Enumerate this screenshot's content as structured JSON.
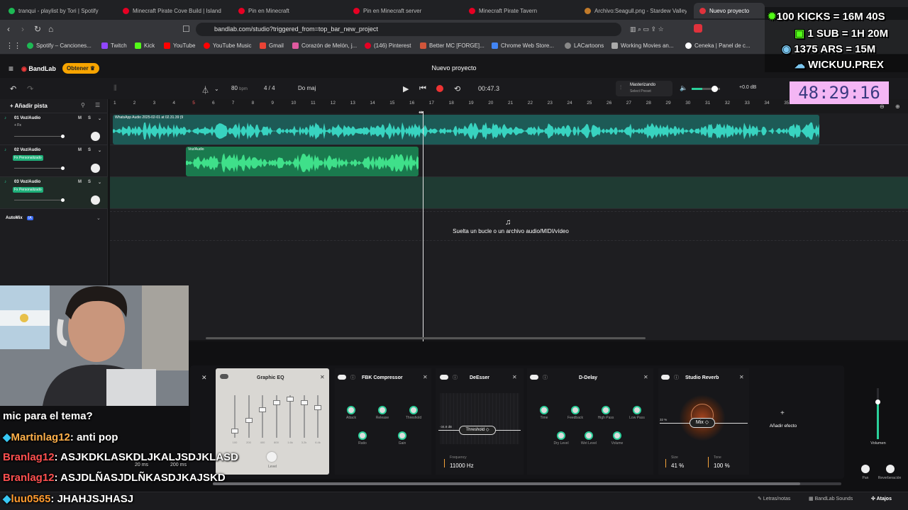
{
  "browser": {
    "tabs": [
      {
        "label": "tranqui - playlist by Tori | Spotify",
        "color": "#1db954"
      },
      {
        "label": "Minecraft Pirate Cove Build | Island",
        "color": "#e60023"
      },
      {
        "label": "Pin en Minecraft",
        "color": "#e60023"
      },
      {
        "label": "Pin en Minecraft server",
        "color": "#e60023"
      },
      {
        "label": "Minecraft Pirate Tavern",
        "color": "#e60023"
      },
      {
        "label": "Archivo:Seagull.png - Stardew Valley",
        "color": "#c27b2a"
      },
      {
        "label": "Nuevo proyecto",
        "color": "#e0323c"
      }
    ],
    "url": "bandlab.com/studio?triggered_from=top_bar_new_project",
    "bookmarks": [
      {
        "label": "Spotify – Canciones...",
        "color": "#1db954"
      },
      {
        "label": "Twitch",
        "color": "#9146ff"
      },
      {
        "label": "Kick",
        "color": "#53fc18"
      },
      {
        "label": "YouTube",
        "color": "#ff0000"
      },
      {
        "label": "YouTube Music",
        "color": "#ff0000"
      },
      {
        "label": "Gmail",
        "color": "#ea4335"
      },
      {
        "label": "Corazón de Melón, j...",
        "color": "#e05aa0"
      },
      {
        "label": "(146) Pinterest",
        "color": "#e60023"
      },
      {
        "label": "Better MC [FORGE]...",
        "color": "#d0553a"
      },
      {
        "label": "Chrome Web Store...",
        "color": "#4285f4"
      },
      {
        "label": "LACartoons",
        "color": "#888888"
      },
      {
        "label": "Working Movies an...",
        "color": "#aaaaaa"
      },
      {
        "label": "Ceneka | Panel de c...",
        "color": "#ffffff"
      }
    ]
  },
  "app": {
    "logo": "BandLab",
    "upgrade_label": "Obtener",
    "project_title": "Nuevo proyecto",
    "tempo": "80",
    "tempo_unit": "bpm",
    "time_sig": "4 / 4",
    "key": "Do maj",
    "time": "00:47.3",
    "mastering_title": "Masterizando",
    "mastering_sub": "Select Preset",
    "db": "+0.0 dB",
    "add_track": "Añadir pista",
    "automix": "AutoMix",
    "automix_badge": "IA",
    "drop_hint": "Suelta un bucle o un archivo audio/MIDI/vídeo",
    "tracks": [
      {
        "name": "01 Voz/Audio",
        "badge": "+ Fx"
      },
      {
        "name": "02 Voz/Audio",
        "badge": "Fx Personalizado"
      },
      {
        "name": "03 Voz/Audio",
        "badge": "Fx Personalizado"
      }
    ],
    "track_buttons": [
      "M",
      "S"
    ],
    "clips": [
      {
        "label": "WhatsApp Audio 2025-02-01 at 02.31.39 (9",
        "color": "#2fb5a8"
      },
      {
        "label": "Voz/Audio",
        "color": "#23b06f"
      }
    ],
    "ruler": [
      "1",
      "2",
      "3",
      "4",
      "5",
      "6",
      "7",
      "8",
      "9",
      "10",
      "11",
      "12",
      "13",
      "14",
      "15",
      "16",
      "17",
      "18",
      "19",
      "20",
      "21",
      "22",
      "23",
      "24",
      "25",
      "26",
      "27",
      "28",
      "29",
      "30",
      "31",
      "32",
      "33",
      "34",
      "35"
    ]
  },
  "effects": {
    "graphic_eq": {
      "title": "Graphic EQ",
      "level": "Level",
      "freqs": [
        "100",
        "200",
        "400",
        "800",
        "1.6k",
        "3.2k",
        "6.4k"
      ]
    },
    "compressor": {
      "title": "FBK Compressor",
      "knobs": [
        "Attack",
        "Release",
        "Threshold",
        "Ratio",
        "Gain"
      ]
    },
    "deesser": {
      "title": "DeEsser",
      "threshold_label": "Threshold",
      "threshold_value": "-34.8 dB",
      "freq_label": "Frequency",
      "freq_value": "11000 Hz"
    },
    "delay": {
      "title": "D-Delay",
      "knobs": [
        "Time",
        "Feedback",
        "High Pass",
        "Low Pass",
        "Dry Level",
        "Wet Level",
        "Volume"
      ]
    },
    "reverb": {
      "title": "Studio Reverb",
      "mix_label": "Mix",
      "mix_value": "32 %",
      "size_label": "Size",
      "size_value": "41 %",
      "tone_label": "Tone",
      "tone_value": "100 %"
    },
    "add_effect": "Añadir efecto",
    "volume_label": "Volumen",
    "pan_label": "Pan",
    "reverb_label": "Reverberación"
  },
  "statusbar": {
    "lyrics": "Letras/notas",
    "sounds": "BandLab Sounds",
    "shortcuts": "Atajos"
  },
  "stream_overlay": {
    "lines": [
      "100 KICKS = 16M 40S",
      "1 SUB = 1H 20M",
      "1375 ARS = 15M",
      "WICKUU.PREX"
    ],
    "timer": "48:29:16"
  },
  "chat": [
    {
      "user": "",
      "text": "mic para el tema?"
    },
    {
      "user": "Martinlag12",
      "text": ": anti pop"
    },
    {
      "user": "Branlag12",
      "text": ": ASJKDKLASKDLJKALJSDJKLASD"
    },
    {
      "user": "Branlag12",
      "text": ": ASJDLÑASJDLÑKASDJKAJSKD"
    },
    {
      "user": "luu0565",
      "text": ": JHAHJSJHASJ"
    }
  ],
  "delay_small": {
    "a": "20 ms",
    "b": "200 ms"
  }
}
